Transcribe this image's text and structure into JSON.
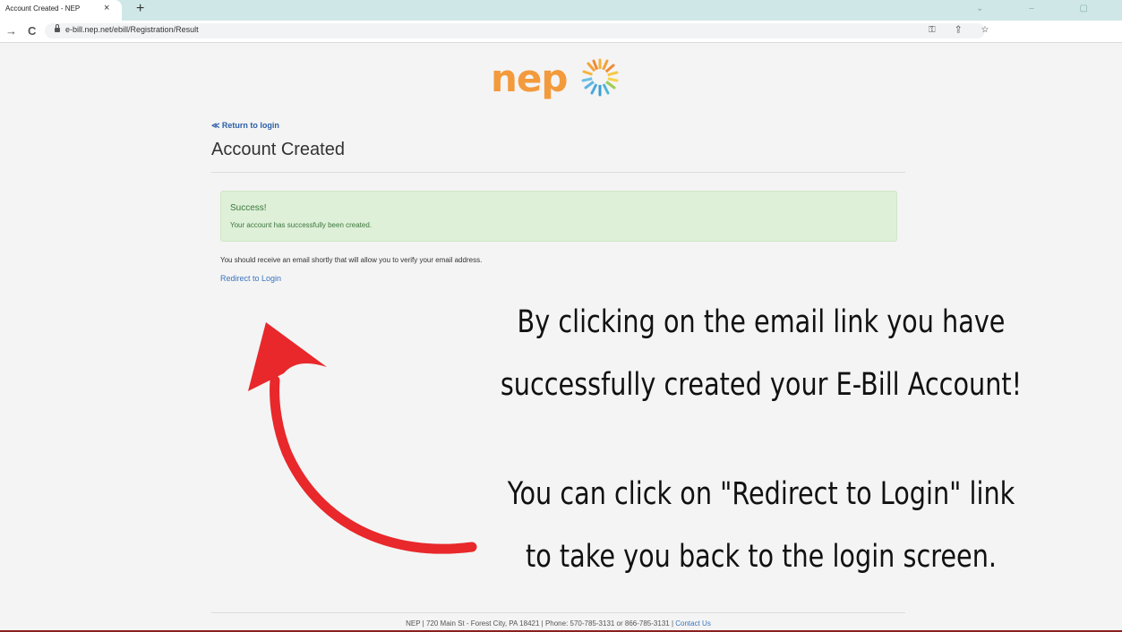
{
  "browser": {
    "tab_title": "Account Created - NEP",
    "tab_close": "×",
    "new_tab": "+",
    "window_controls": "⌄ – ▢",
    "nav_forward": "→",
    "nav_reload": "C",
    "url": "e-bill.nep.net/ebill/Registration/Result",
    "omnibox_icons": "⚿ ⇪ ☆"
  },
  "page": {
    "logo_text": "nep",
    "return_link": "≪ Return to login",
    "title": "Account Created",
    "alert": {
      "title": "Success!",
      "message": "Your account has successfully been created."
    },
    "info_text": "You should receive an email shortly that will allow you to verify your email address.",
    "redirect_link": "Redirect to Login"
  },
  "overlay": {
    "line1": "By clicking on the email link you have",
    "line2": "successfully created your E-Bill Account!",
    "line3": "You can click on \"Redirect to Login\" link",
    "line4": "to take you back to the login screen.",
    "arrow_color": "#e8282b"
  },
  "footer": {
    "text": "NEP | 720 Main St - Forest City, PA 18421 | Phone: 570-785-3131 or 866-785-3131 | ",
    "contact_link": "Contact Us"
  },
  "colors": {
    "logo_orange": "#f39a3c",
    "link_blue": "#3a74bf",
    "success_bg": "#def0d8",
    "success_text": "#3c763d"
  }
}
